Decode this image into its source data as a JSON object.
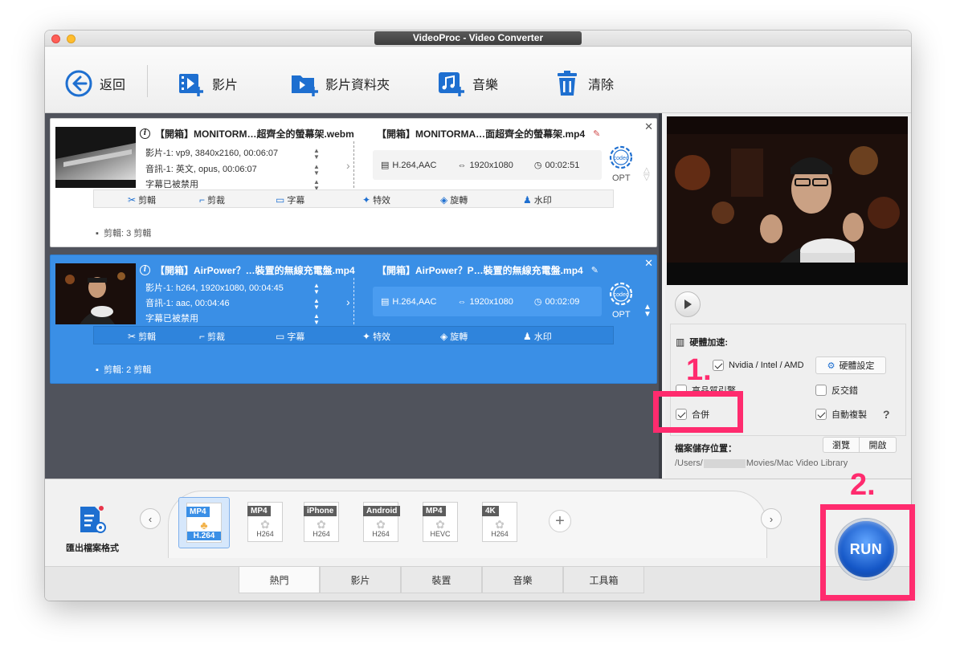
{
  "window": {
    "title": "VideoProc - Video Converter"
  },
  "toolbar": {
    "back": "返回",
    "video": "影片",
    "video_folder": "影片資料夾",
    "music": "音樂",
    "clear": "清除"
  },
  "items": [
    {
      "src_name": "【開箱】MONITORM…超齊全的螢幕架.webm",
      "video_line": "影片-1: vp9, 3840x2160, 00:06:07",
      "audio_line": "音訊-1: 英文, opus, 00:06:07",
      "subtitle_line": "字幕已被禁用",
      "dst_name": "【開箱】MONITORMA…面超齊全的螢幕架.mp4",
      "codec": "H.264,AAC",
      "resolution": "1920x1080",
      "duration": "00:02:51",
      "opt": "OPT",
      "clip_note": "剪輯: 3 剪輯"
    },
    {
      "src_name": "【開箱】AirPower？…裝置的無線充電盤.mp4",
      "video_line": "影片-1: h264, 1920x1080, 00:04:45",
      "audio_line": "音訊-1: aac, 00:04:46",
      "subtitle_line": "字幕已被禁用",
      "dst_name": "【開箱】AirPower？P…裝置的無線充電盤.mp4",
      "codec": "H.264,AAC",
      "resolution": "1920x1080",
      "duration": "00:02:09",
      "opt": "OPT",
      "clip_note": "剪輯: 2 剪輯"
    }
  ],
  "edit_tools": {
    "cut": "剪輯",
    "crop": "剪裁",
    "subtitle": "字幕",
    "effect": "特效",
    "rotate": "旋轉",
    "watermark": "水印"
  },
  "settings": {
    "hw_accel_label": "硬體加速:",
    "hw_option": "Nvidia /  Intel / AMD",
    "hw_settings_btn": "硬體設定",
    "engine": "高品質引擎",
    "deinterlace": "反交錯",
    "merge": "合併",
    "auto_copy": "自動複製",
    "help": "?",
    "save_label": "檔案儲存位置：",
    "browse": "瀏覽",
    "open": "開啟",
    "path_prefix": "/Users/",
    "path_suffix": "Movies/Mac Video Library"
  },
  "formats": [
    {
      "top": "MP4",
      "bottom": "H.264",
      "selected": true
    },
    {
      "top": "MP4",
      "bottom": "H264"
    },
    {
      "top": "iPhone",
      "bottom": "H264"
    },
    {
      "top": "Android",
      "bottom": "H264"
    },
    {
      "top": "MP4",
      "bottom": "HEVC"
    },
    {
      "top": "4K",
      "bottom": "H264"
    }
  ],
  "export_label": "匯出檔案格式",
  "tabs": [
    "熱門",
    "影片",
    "裝置",
    "音樂",
    "工具箱"
  ],
  "run_label": "RUN",
  "annotations": {
    "step1": "1.",
    "step2": "2."
  },
  "colors": {
    "accent": "#3a8fe6",
    "highlight": "#ff2b6e",
    "icon_blue": "#1e6fd0"
  }
}
